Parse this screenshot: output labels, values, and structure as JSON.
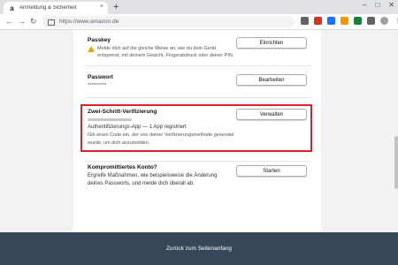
{
  "browser": {
    "tab_title": "Anmeldung & Sicherheit",
    "url": "https://www.amazon.de",
    "new_tab": "+",
    "win_controls": [
      "–",
      "□",
      "✕"
    ],
    "tab_close": "×"
  },
  "sections": {
    "passkey": {
      "title": "Passkey",
      "text_line1": "Melde dich auf die gleiche Weise an, wie du dein Gerät",
      "text_line2": "entsperrst, mit deinem Gesicht, Fingerabdruck oder deiner PIN.",
      "button": "Einrichten"
    },
    "password": {
      "title": "Passwort",
      "masked": "**********",
      "button": "Bearbeiten"
    },
    "two_step": {
      "title": "Zwei-Schritt-Verifizierung",
      "app_line": "Authentifizierungs-App — 1 App registriert",
      "desc_line1": "Gib einen Code ein, der von deiner Verifizierungsmethode gesendet",
      "desc_line2": "wurde, um dich anzumelden.",
      "button": "Verwalten"
    },
    "compromised": {
      "title": "Kompromittiertes Konto?",
      "text_line1": "Ergreife Maßnahmen, wie beispielsweise die Änderung",
      "text_line2": "deines Passworts, und melde dich überall ab.",
      "button": "Starten"
    }
  },
  "footer": {
    "back_to_top": "Zurück zum Seitenanfang"
  }
}
